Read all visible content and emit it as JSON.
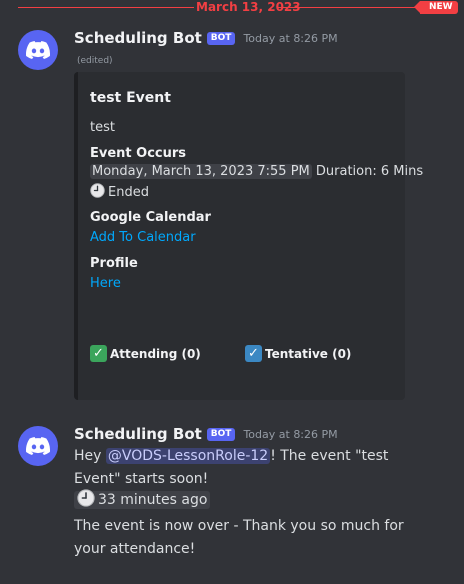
{
  "divider": {
    "date": "March 13, 2023",
    "new_badge": "NEW"
  },
  "message1": {
    "username": "Scheduling Bot",
    "bot_tag": "BOT",
    "timestamp": "Today at 8:26 PM",
    "edited": "(edited)",
    "embed": {
      "title": "test Event",
      "description": "test",
      "fields": {
        "occurs_name": "Event Occurs",
        "occurs_time": "Monday, March 13, 2023 7:55 PM",
        "duration": "Duration: 6 Mins",
        "ended": "Ended",
        "gcal_name": "Google Calendar",
        "gcal_link": "Add To Calendar",
        "profile_name": "Profile",
        "profile_link": "Here"
      },
      "reactions": {
        "attending": "Attending (0)",
        "tentative": "Tentative (0)"
      }
    }
  },
  "message2": {
    "username": "Scheduling Bot",
    "bot_tag": "BOT",
    "timestamp": "Today at 8:26 PM",
    "line1_pre": "Hey ",
    "mention": "@VODS-LessonRole-12",
    "line1_post": "! The event \"test Event\" starts soon!",
    "relative_time": "33 minutes ago",
    "line2": "The event is now over - Thank you so much for your attendance!"
  },
  "colors": {
    "accent": "#5865f2",
    "new_badge": "#f23f43",
    "link": "#00a8fc",
    "attending": "#3ba55c",
    "tentative": "#3b88c3"
  },
  "icons": {
    "avatar": "discord-logo-icon",
    "ended": "clock-icon",
    "attending": "check-mark-icon",
    "tentative": "check-box-icon"
  }
}
